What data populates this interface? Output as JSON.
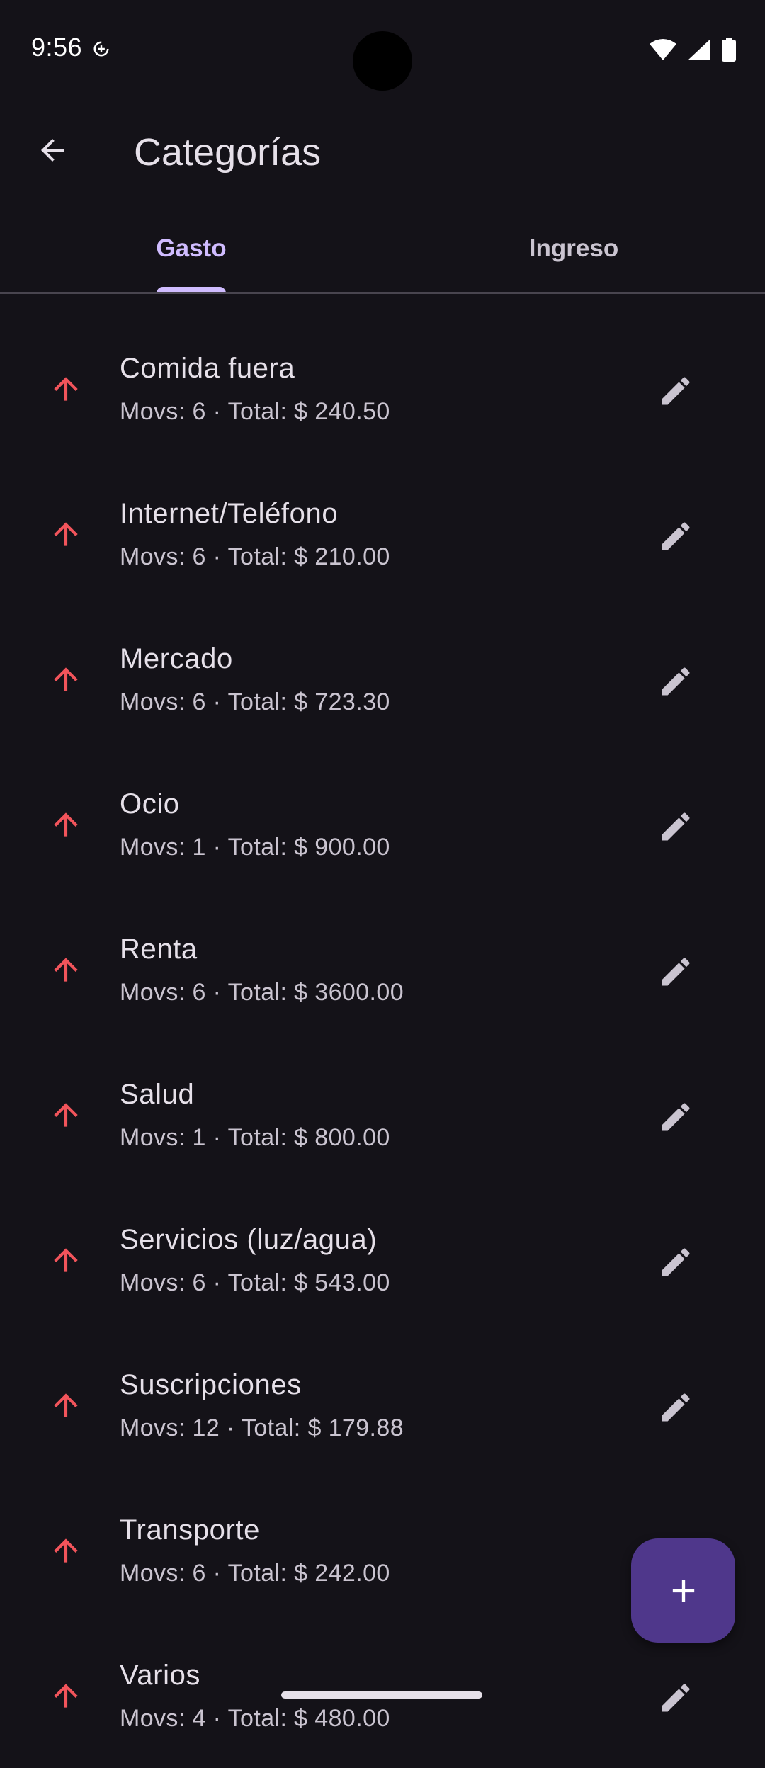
{
  "status_bar": {
    "time": "9:56",
    "icons": [
      "data-saver-icon",
      "wifi-icon",
      "signal-icon",
      "battery-icon"
    ]
  },
  "app_bar": {
    "title": "Categorías",
    "back_icon": "arrow-back-icon"
  },
  "tabs": [
    {
      "label": "Gasto",
      "selected": true
    },
    {
      "label": "Ingreso",
      "selected": false
    }
  ],
  "categories": [
    {
      "name": "Comida fuera",
      "summary": "Movs: 6 · Total: $ 240.50",
      "icon": "arrow-upward-icon"
    },
    {
      "name": "Internet/Teléfono",
      "summary": "Movs: 6 · Total: $ 210.00",
      "icon": "arrow-upward-icon"
    },
    {
      "name": "Mercado",
      "summary": "Movs: 6 · Total: $ 723.30",
      "icon": "arrow-upward-icon"
    },
    {
      "name": "Ocio",
      "summary": "Movs: 1 · Total: $ 900.00",
      "icon": "arrow-upward-icon"
    },
    {
      "name": "Renta",
      "summary": "Movs: 6 · Total: $ 3600.00",
      "icon": "arrow-upward-icon"
    },
    {
      "name": "Salud",
      "summary": "Movs: 1 · Total: $ 800.00",
      "icon": "arrow-upward-icon"
    },
    {
      "name": "Servicios (luz/agua)",
      "summary": "Movs: 6 · Total: $ 543.00",
      "icon": "arrow-upward-icon"
    },
    {
      "name": "Suscripciones",
      "summary": "Movs: 12 · Total: $ 179.88",
      "icon": "arrow-upward-icon"
    },
    {
      "name": "Transporte",
      "summary": "Movs: 6 · Total: $ 242.00",
      "icon": "arrow-upward-icon"
    },
    {
      "name": "Varios",
      "summary": "Movs: 4 · Total: $ 480.00",
      "icon": "arrow-upward-icon"
    }
  ],
  "fab": {
    "icon": "add-icon"
  },
  "colors": {
    "background": "#141218",
    "expense_arrow": "#F2545B",
    "accent": "#D0BCFF",
    "fab": "#4F378B",
    "on_surface": "#E6E0E9",
    "on_surface_variant": "#CAC4D0"
  }
}
